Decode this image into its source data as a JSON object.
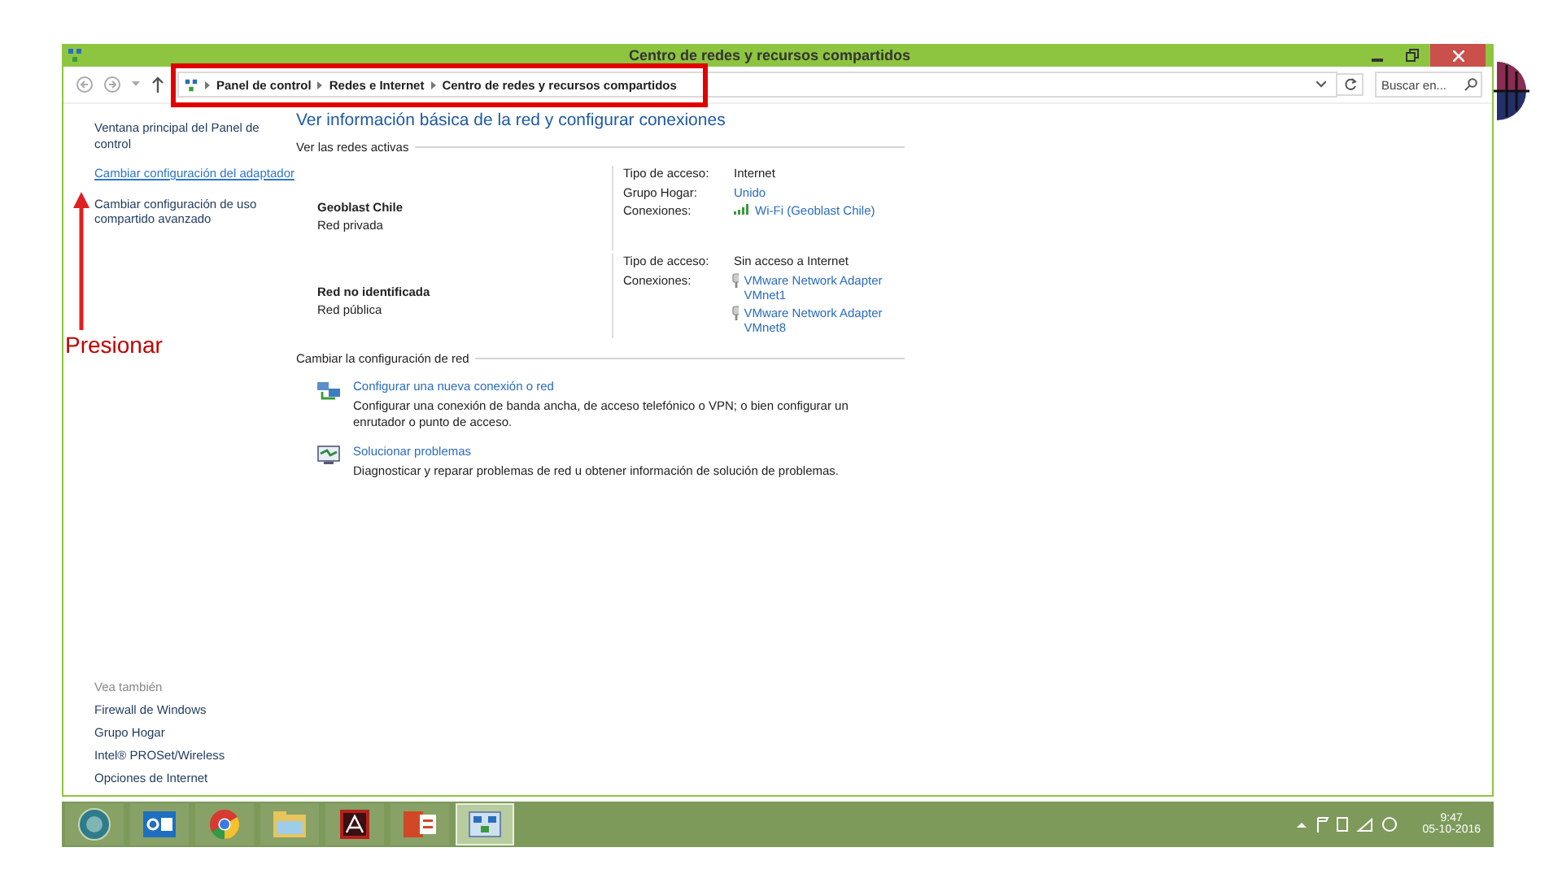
{
  "window": {
    "title": "Centro de redes y recursos compartidos"
  },
  "breadcrumb": [
    "Panel de control",
    "Redes e Internet",
    "Centro de redes y recursos compartidos"
  ],
  "search": {
    "placeholder": "Buscar en..."
  },
  "sidebar": {
    "items": [
      {
        "label": "Ventana principal del Panel de control",
        "hovered": false
      },
      {
        "label": "Cambiar configuración del adaptador",
        "hovered": true
      },
      {
        "label": "Cambiar configuración de uso compartido avanzado",
        "hovered": false
      }
    ],
    "see_also_label": "Vea también",
    "see_also": [
      "Firewall de Windows",
      "Grupo Hogar",
      "Intel® PROSet/Wireless",
      "Opciones de Internet"
    ]
  },
  "heading": "Ver información básica de la red y configurar conexiones",
  "active_networks": {
    "label": "Ver las redes activas",
    "networks": [
      {
        "name": "Geoblast Chile",
        "category": "Red privada",
        "rows": [
          {
            "label": "Tipo de acceso:",
            "kind": "text",
            "values": [
              {
                "text": "Internet",
                "kind": "plain"
              }
            ]
          },
          {
            "label": "Grupo Hogar:",
            "kind": "link",
            "values": [
              {
                "text": "Unido",
                "kind": "plain"
              }
            ]
          },
          {
            "label": "Conexiones:",
            "kind": "link",
            "values": [
              {
                "text": "Wi-Fi (Geoblast Chile)",
                "kind": "wifi"
              }
            ]
          }
        ]
      },
      {
        "name": "Red no identificada",
        "category": "Red pública",
        "rows": [
          {
            "label": "Tipo de acceso:",
            "kind": "text",
            "values": [
              {
                "text": "Sin acceso a Internet",
                "kind": "plain"
              }
            ]
          },
          {
            "label": "Conexiones:",
            "kind": "link",
            "values": [
              {
                "text": "VMware Network Adapter VMnet1",
                "kind": "adapter"
              },
              {
                "text": "VMware Network Adapter VMnet8",
                "kind": "adapter"
              }
            ]
          }
        ]
      }
    ]
  },
  "change_settings": {
    "label": "Cambiar la configuración de red",
    "tasks": [
      {
        "kind": "setup",
        "link": "Configurar una nueva conexión o red",
        "description": "Configurar una conexión de banda ancha, de acceso telefónico o VPN; o bien configurar un enrutador o punto de acceso."
      },
      {
        "kind": "troubleshoot",
        "link": "Solucionar problemas",
        "description": "Diagnosticar y reparar problemas de red u obtener información de solución de problemas."
      }
    ]
  },
  "taskbar": {
    "apps": [
      {
        "kind": "start",
        "active": false
      },
      {
        "kind": "outlook",
        "active": false
      },
      {
        "kind": "chrome",
        "active": false
      },
      {
        "kind": "folder",
        "active": false
      },
      {
        "kind": "pdf",
        "active": false
      },
      {
        "kind": "powerpoint",
        "active": false
      },
      {
        "kind": "network",
        "active": true
      }
    ],
    "time": "9:47",
    "date": "05-10-2016"
  },
  "annotation": {
    "text": "Presionar"
  }
}
